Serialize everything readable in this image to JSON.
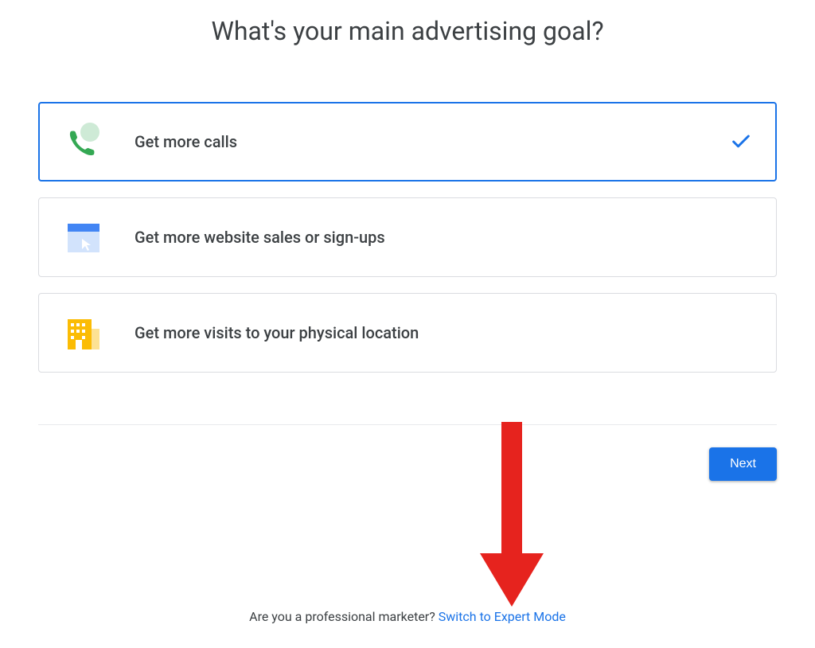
{
  "heading": "What's your main advertising goal?",
  "options": [
    {
      "label": "Get more calls",
      "selected": true
    },
    {
      "label": "Get more website sales or sign-ups",
      "selected": false
    },
    {
      "label": "Get more visits to your physical location",
      "selected": false
    }
  ],
  "next_button": "Next",
  "footer": {
    "prompt": "Are you a professional marketer? ",
    "link": "Switch to Expert Mode"
  }
}
